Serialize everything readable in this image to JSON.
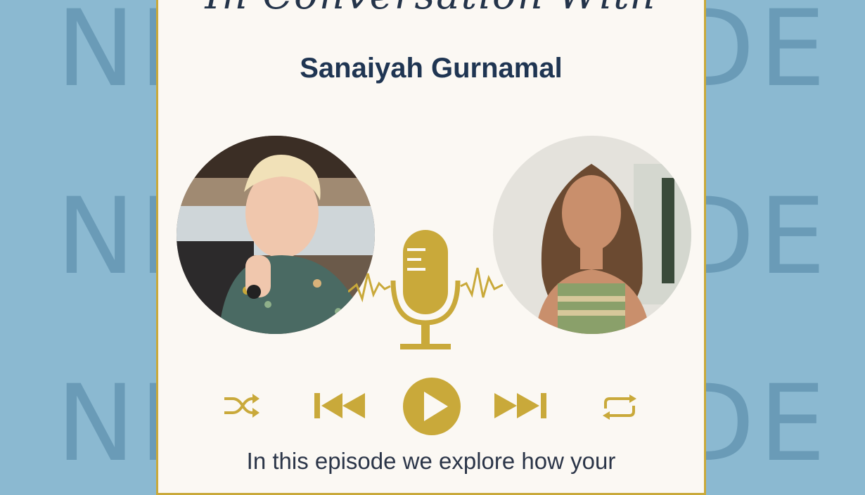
{
  "background": {
    "watermark_text": "NEW EPISODE",
    "color": "#8bb9d1"
  },
  "card": {
    "script_title": "In Conversation With",
    "guest_name": "Sanaiyah Gurnamal",
    "description": "In this episode we explore how your"
  },
  "colors": {
    "accent_gold": "#c9a93a",
    "navy": "#1f3552",
    "card": "#fbf8f3"
  },
  "icons": {
    "left_portrait": "host-portrait",
    "right_portrait": "guest-portrait",
    "center": "microphone-icon",
    "controls": [
      "shuffle-icon",
      "previous-icon",
      "play-icon",
      "next-icon",
      "repeat-icon"
    ]
  }
}
